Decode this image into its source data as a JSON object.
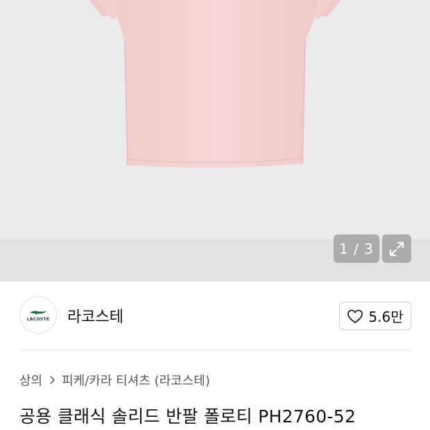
{
  "gallery": {
    "counter": "1 / 3",
    "expand_icon": "expand-arrows-icon",
    "image_alt": "pink short sleeve polo shirt"
  },
  "brand": {
    "logo_text": "LACOSTE",
    "name": "라코스테",
    "like_icon": "heart-outline-icon",
    "like_count": "5.6만"
  },
  "breadcrumb": {
    "category": "상의",
    "subcategory": "피케/카라 티셔츠 (라코스테)"
  },
  "product": {
    "title": "공용 클래식 솔리드 반팔 폴로티 PH2760-52"
  },
  "colors": {
    "gallery_bg": "#ebebed",
    "shirt": "#f4d2d2",
    "overlay": "#969696"
  }
}
